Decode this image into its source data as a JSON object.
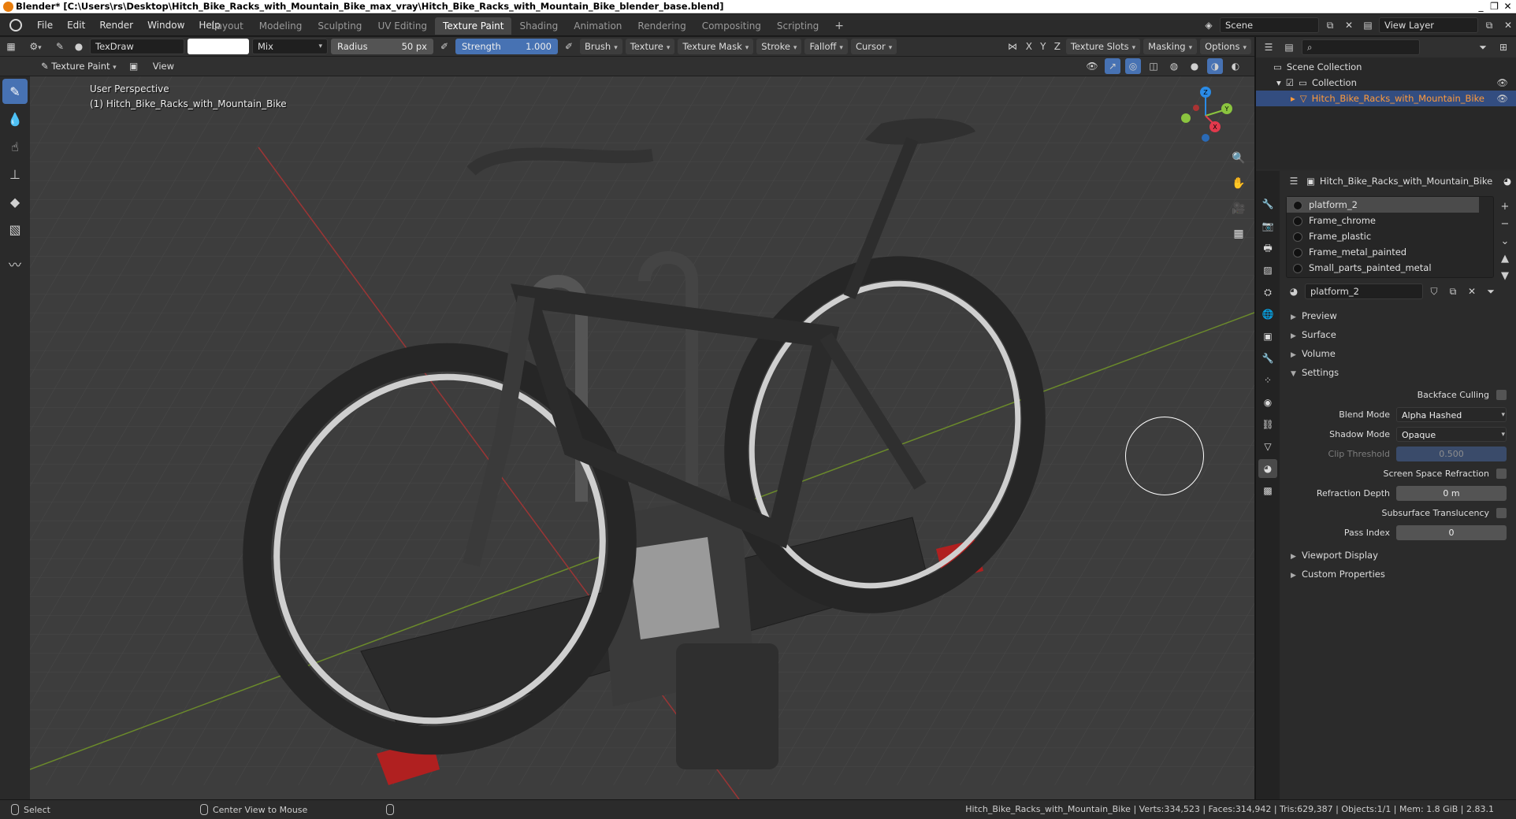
{
  "window": {
    "title": "Blender* [C:\\Users\\rs\\Desktop\\Hitch_Bike_Racks_with_Mountain_Bike_max_vray\\Hitch_Bike_Racks_with_Mountain_Bike_blender_base.blend]",
    "controls": [
      "_",
      "❐",
      "✕"
    ]
  },
  "menus": [
    "File",
    "Edit",
    "Render",
    "Window",
    "Help"
  ],
  "workspace_tabs": [
    "Layout",
    "Modeling",
    "Sculpting",
    "UV Editing",
    "Texture Paint",
    "Shading",
    "Animation",
    "Rendering",
    "Compositing",
    "Scripting"
  ],
  "active_workspace": "Texture Paint",
  "scene": {
    "name": "Scene",
    "view_layer": "View Layer"
  },
  "tool_header": {
    "brush_name": "TexDraw",
    "blend": "Mix",
    "radius_label": "Radius",
    "radius_value": "50 px",
    "strength_label": "Strength",
    "strength_value": "1.000",
    "menus": [
      "Brush",
      "Texture",
      "Texture Mask",
      "Stroke",
      "Falloff",
      "Cursor"
    ],
    "axes": [
      "X",
      "Y",
      "Z"
    ],
    "right_menus": [
      "Texture Slots",
      "Masking",
      "Options"
    ]
  },
  "sub_header": {
    "mode": "Texture Paint",
    "view": "View"
  },
  "viewport": {
    "perspective": "User Perspective",
    "object": "(1) Hitch_Bike_Racks_with_Mountain_Bike",
    "gizmo": {
      "x": "X",
      "y": "Y",
      "z": "Z"
    }
  },
  "outliner": {
    "root": "Scene Collection",
    "collection": "Collection",
    "object": "Hitch_Bike_Racks_with_Mountain_Bike"
  },
  "properties": {
    "object_name": "Hitch_Bike_Racks_with_Mountain_Bike",
    "materials": [
      "platform_2",
      "Frame_chrome",
      "Frame_plastic",
      "Frame_metal_painted",
      "Small_parts_painted_metal"
    ],
    "active_material": "platform_2",
    "panels_top": [
      "Preview",
      "Surface",
      "Volume",
      "Settings"
    ],
    "settings": {
      "backface_culling": "Backface Culling",
      "blend_mode_label": "Blend Mode",
      "blend_mode": "Alpha Hashed",
      "shadow_mode_label": "Shadow Mode",
      "shadow_mode": "Opaque",
      "clip_threshold_label": "Clip Threshold",
      "clip_threshold": "0.500",
      "ssr": "Screen Space Refraction",
      "refraction_depth_label": "Refraction Depth",
      "refraction_depth": "0 m",
      "subsurface": "Subsurface Translucency",
      "pass_index_label": "Pass Index",
      "pass_index": "0"
    },
    "panels_bottom": [
      "Viewport Display",
      "Custom Properties"
    ]
  },
  "statusbar": {
    "select": "Select",
    "center": "Center View to Mouse",
    "stats": "Hitch_Bike_Racks_with_Mountain_Bike | Verts:334,523 | Faces:314,942 | Tris:629,387 | Objects:1/1 | Mem: 1.8 GiB | 2.83.1"
  },
  "colors": {
    "accent": "#4772b3",
    "selection": "#334d80",
    "active_text": "#ff9a3a",
    "axis_x": "#e2394c",
    "axis_y": "#8bc53f",
    "axis_z": "#2a8be6"
  }
}
